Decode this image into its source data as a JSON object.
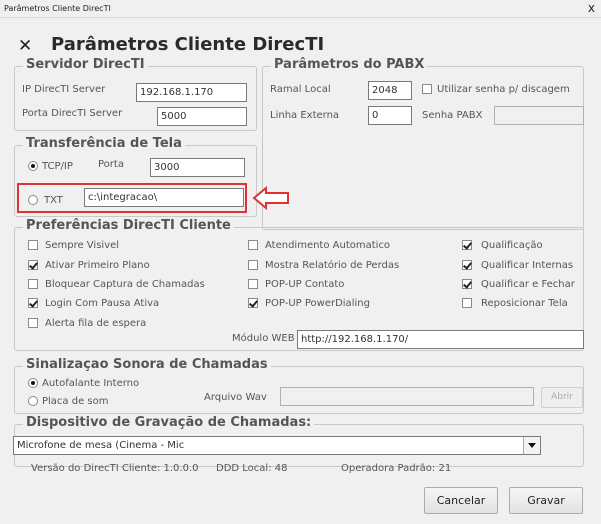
{
  "window": {
    "title": "Parâmetros Cliente DirecTI",
    "close_glyph": "x"
  },
  "header": {
    "icon": "tools-icon",
    "title": "Parâmetros Cliente DirecTI"
  },
  "servidor": {
    "legend": "Servidor DirecTI",
    "ip_label": "IP DirecTI Server",
    "ip_value": "192.168.1.170",
    "porta_label": "Porta DirecTI Server",
    "porta_value": "5000"
  },
  "pabx": {
    "legend": "Parâmetros do PABX",
    "ramal_label": "Ramal Local",
    "ramal_value": "2048",
    "utilizar_senha_label": "Utilizar senha p/ discagem",
    "utilizar_senha_checked": false,
    "linha_label": "Linha Externa",
    "linha_value": "0",
    "senha_label": "Senha PABX",
    "senha_value": ""
  },
  "transferencia": {
    "legend": "Transferência de Tela",
    "tcpip_label": "TCP/IP",
    "tcpip_selected": true,
    "porta_label": "Porta",
    "porta_value": "3000",
    "txt_label": "TXT",
    "txt_selected": false,
    "txt_value": "c:\\integracao\\"
  },
  "preferencias": {
    "legend": "Preferências DirecTI Cliente",
    "col1": [
      {
        "label": "Sempre Visivel",
        "checked": false
      },
      {
        "label": "Ativar Primeiro Plano",
        "checked": true
      },
      {
        "label": "Bloquear Captura de Chamadas",
        "checked": false
      },
      {
        "label": "Login Com Pausa Ativa",
        "checked": true
      },
      {
        "label": "Alerta fila de espera",
        "checked": false
      }
    ],
    "col2": [
      {
        "label": "Atendimento Automatico",
        "checked": false
      },
      {
        "label": "Mostra Relatório de Perdas",
        "checked": false
      },
      {
        "label": "POP-UP Contato",
        "checked": false
      },
      {
        "label": "POP-UP PowerDialing",
        "checked": true
      }
    ],
    "col3": [
      {
        "label": "Qualificação",
        "checked": true
      },
      {
        "label": "Qualificar Internas",
        "checked": true
      },
      {
        "label": "Qualificar e Fechar",
        "checked": true
      },
      {
        "label": "Reposicionar Tela",
        "checked": false
      }
    ],
    "modulo_web_label": "Módulo WEB",
    "modulo_web_value": "http://192.168.1.170/"
  },
  "sinalizacao": {
    "legend": "Sinalizaçao Sonora de Chamadas",
    "autofalante_label": "Autofalante Interno",
    "autofalante_selected": true,
    "placa_label": "Placa de som",
    "placa_selected": false,
    "arquivo_label": "Arquivo Wav",
    "arquivo_value": "",
    "abrir_label": "Abrir"
  },
  "gravacao": {
    "legend": "Dispositivo de Gravação de Chamadas:",
    "selected": "Microfone de mesa (Cinema - Mic"
  },
  "info": {
    "versao": "Versão do DirecTI Cliente: 1.0.0.0",
    "ddd": "DDD Local: 48",
    "operadora": "Operadora Padrão: 21"
  },
  "buttons": {
    "cancelar": "Cancelar",
    "gravar": "Gravar"
  },
  "annotation": {
    "color": "#dd3333"
  }
}
